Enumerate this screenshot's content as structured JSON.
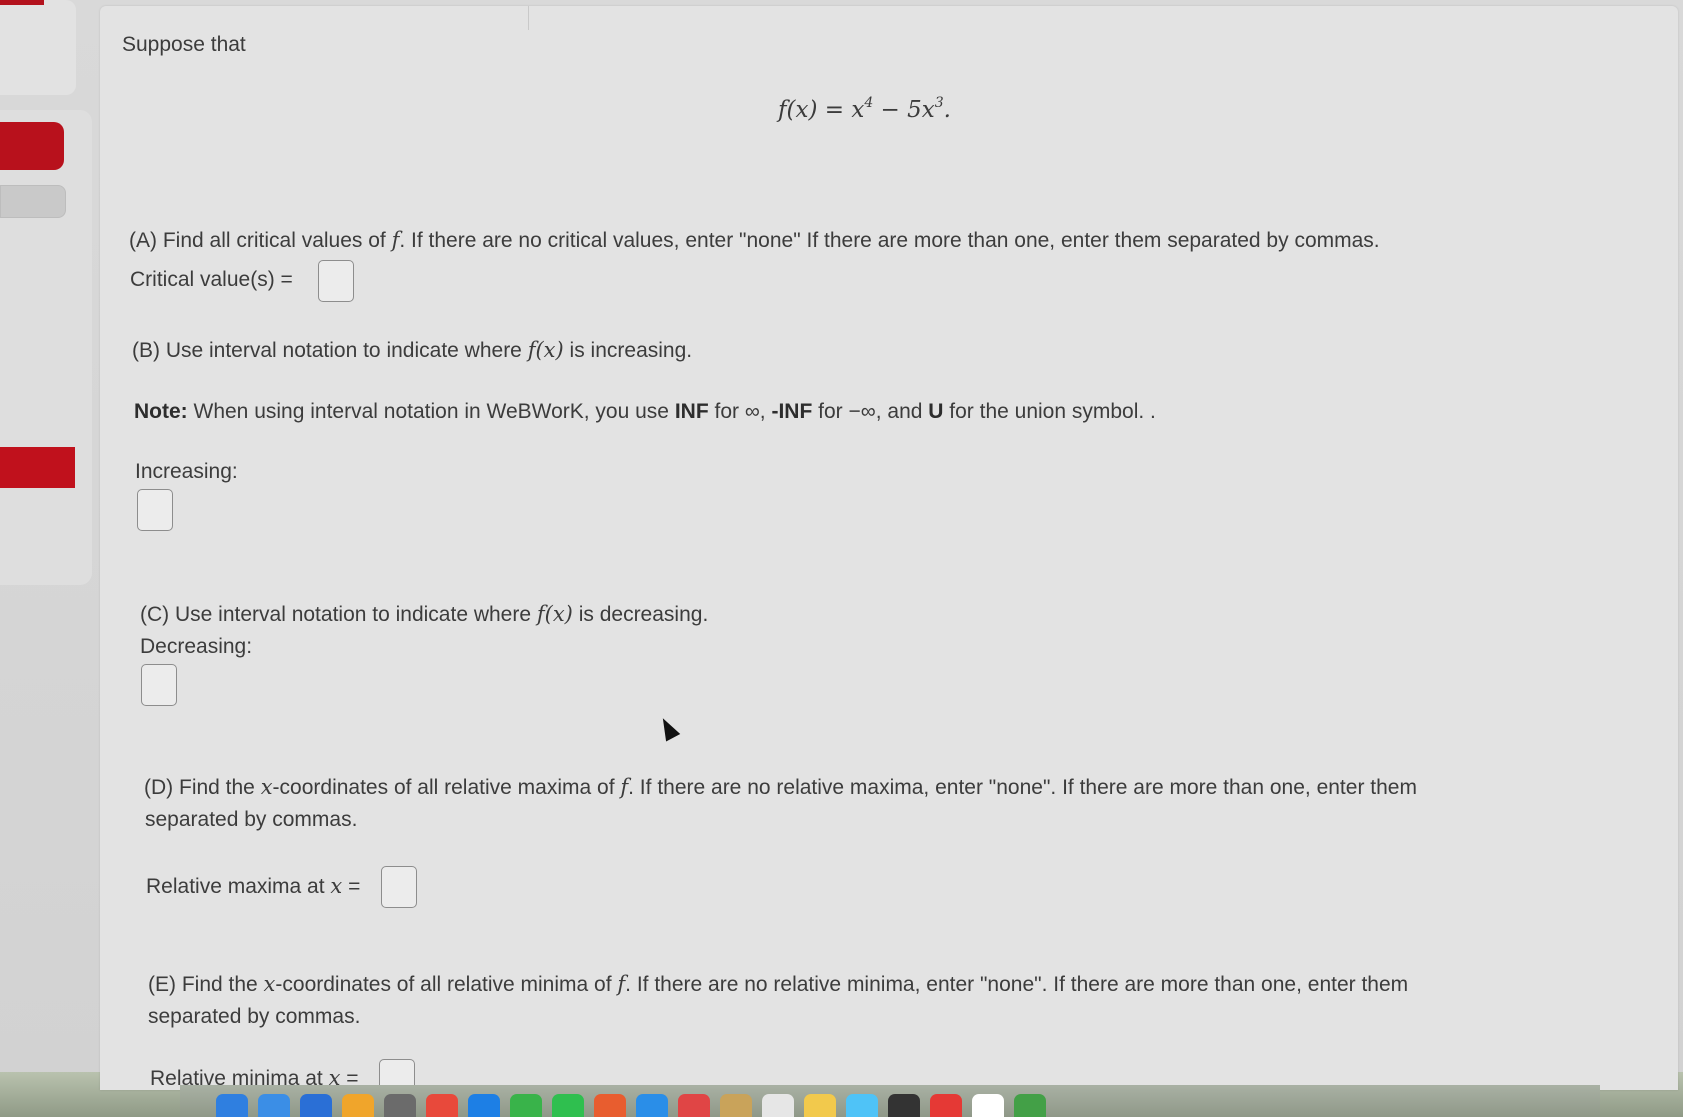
{
  "intro": "Suppose that",
  "function_def": {
    "lhs": "f(x) = ",
    "term1_base": "x",
    "term1_exp": "4",
    "minus": " − 5",
    "term2_base": "x",
    "term2_exp": "3",
    "end": "."
  },
  "part_a": {
    "text_before": "(A) Find all critical values of ",
    "f": "f",
    "text_after": ". If there are no critical values, enter \"none\" If there are more than one, enter them separated by commas.",
    "label": "Critical value(s) ="
  },
  "part_b": {
    "text_before": "(B) Use interval notation to indicate where ",
    "fx": "f(x)",
    "text_after": " is increasing.",
    "label": "Increasing:"
  },
  "note": {
    "bold": "Note:",
    "t1": " When using interval notation in WeBWorK, you use ",
    "inf": "INF",
    "t2": " for ∞, ",
    "neg_inf": "-INF",
    "t3": " for −∞, and ",
    "u": "U",
    "t4": " for the union symbol. ."
  },
  "part_c": {
    "text_before": "(C) Use interval notation to indicate where ",
    "fx": "f(x)",
    "text_after": " is decreasing.",
    "label": "Decreasing:"
  },
  "part_d": {
    "text_before": "(D) Find the ",
    "x": "x",
    "text_mid": "-coordinates of all relative maxima of ",
    "f": "f",
    "text_after": ". If there are no relative maxima, enter \"none\". If there are more than one, enter them",
    "line2": "separated by commas.",
    "label": "Relative maxima at ",
    "label_x": "x",
    "label_eq": " ="
  },
  "part_e": {
    "text_before": "(E) Find the ",
    "x": "x",
    "text_mid": "-coordinates of all relative minima of ",
    "f": "f",
    "text_after": ". If there are no relative minima, enter \"none\". If there are more than one, enter them",
    "line2": "separated by commas.",
    "label": "Relative minima at ",
    "label_x": "x",
    "label_eq": " ="
  },
  "dock_colors": [
    "#2f7fe0",
    "#3b8ee6",
    "#2a6fd6",
    "#f0a52b",
    "#6b6b6b",
    "#e8493b",
    "#1d7fe5",
    "#39b34a",
    "#2fbf4f",
    "#e85d2f",
    "#2a8ee8",
    "#e04545",
    "#c9a35a",
    "#e6e6e6",
    "#f2c94c",
    "#4fc3f7",
    "#333333",
    "#e53935",
    "#ffffff",
    "#43a047"
  ]
}
